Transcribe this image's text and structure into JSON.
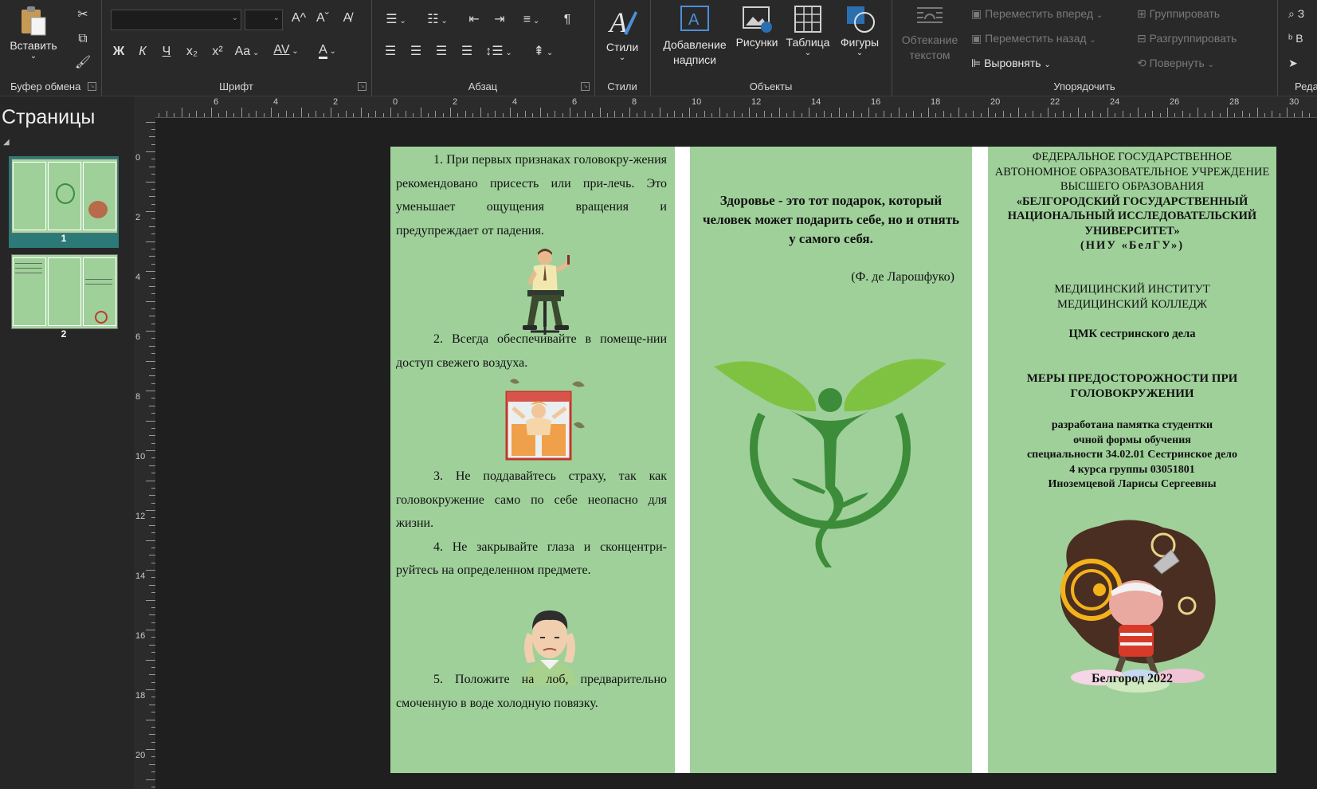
{
  "ribbon": {
    "clipboard": {
      "label": "Буфер обмена",
      "paste": "Вставить"
    },
    "font": {
      "label": "Шрифт",
      "bold": "Ж",
      "italic": "К",
      "underline": "Ч",
      "subscript": "x₂",
      "superscript": "x²",
      "case": "Aa",
      "spacing": "AV",
      "color": "A",
      "grow": "A^",
      "shrink": "Aˇ"
    },
    "paragraph": {
      "label": "Абзац",
      "pilcrow": "¶"
    },
    "styles": {
      "label": "Стили",
      "button": "Стили"
    },
    "objects": {
      "label": "Объекты",
      "textbox": "Добавление надписи",
      "pictures": "Рисунки",
      "table": "Таблица",
      "shapes": "Фигуры"
    },
    "arrange": {
      "label": "Упорядочить",
      "wrap": "Обтекание текстом",
      "forward": "Переместить вперед",
      "backward": "Переместить назад",
      "align": "Выровнять",
      "group": "Группировать",
      "ungroup": "Разгруппировать",
      "rotate": "Повернуть"
    },
    "editing": {
      "label": "Реда",
      "find": "З",
      "replace": "В"
    }
  },
  "pages_panel": {
    "title": "Страницы",
    "pages": [
      "1",
      "2"
    ]
  },
  "ruler": {
    "h": [
      "6",
      "4",
      "2",
      "0",
      "2",
      "4",
      "6",
      "8",
      "10",
      "12",
      "14",
      "16",
      "18",
      "20",
      "22",
      "24",
      "26",
      "28",
      "30"
    ],
    "v": [
      "0",
      "2",
      "4",
      "6",
      "8",
      "10",
      "12",
      "14",
      "16",
      "18",
      "20"
    ]
  },
  "brochure": {
    "left": {
      "item1": "1. При первых признаках головокру-жения рекомендовано присесть или при-лечь. Это уменьшает ощущения вращения и предупреждает от падения.",
      "item2": "2. Всегда обеспечивайте в помеще-нии доступ свежего воздуха.",
      "item3": "3. Не поддавайтесь страху, так как головокружение само по себе неопасно для жизни.",
      "item4": "4. Не закрывайте глаза и сконцентри-руйтесь на определенном предмете.",
      "item5": "5. Положите на лоб, предварительно смоченную в воде холодную повязку."
    },
    "middle": {
      "quote": "Здоровье - это тот подарок, который человек может подарить себе, но и отнять у самого себя.",
      "author": "(Ф. де Ларошфуко)"
    },
    "right": {
      "org1": "ФЕДЕРАЛЬНОЕ ГОСУДАРСТВЕННОЕ АВТОНОМНОЕ ОБРАЗОВАТЕЛЬНОЕ УЧРЕЖДЕНИЕ ВЫСШЕГО ОБРАЗОВАНИЯ",
      "org2": "«БЕЛГОРОДСКИЙ ГОСУДАРСТВЕННЫЙ НАЦИОНАЛЬНЫЙ ИССЛЕДОВАТЕЛЬСКИЙ УНИВЕРСИТЕТ»",
      "org3": "(НИУ «БелГУ»)",
      "inst1": "МЕДИЦИНСКИЙ ИНСТИТУТ",
      "inst2": "МЕДИЦИНСКИЙ КОЛЛЕДЖ",
      "dept": "ЦМК сестринского дела",
      "title": "МЕРЫ ПРЕДОСТОРОЖНОСТИ ПРИ ГОЛОВОКРУЖЕНИИ",
      "author": [
        "разработана памятка студентки",
        "очной формы обучения",
        "специальности 34.02.01 Сестринское дело",
        "4 курса группы 03051801",
        "Иноземцевой Ларисы Сергеевны"
      ],
      "city": "Белгород 2022"
    }
  },
  "colors": {
    "panel": "#9fd09a",
    "ribbon": "#292929",
    "logo_light": "#7fc241",
    "logo_dark": "#3c8c3a"
  }
}
